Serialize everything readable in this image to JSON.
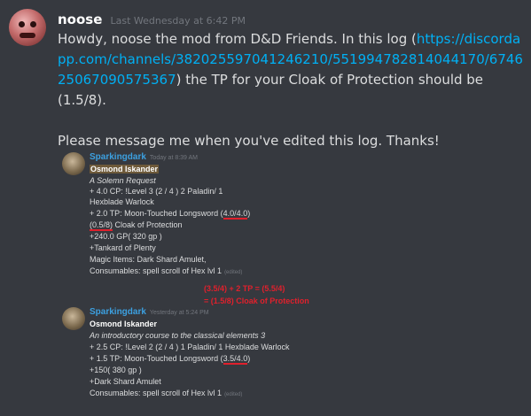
{
  "message": {
    "author": "noose",
    "timestamp": "Last Wednesday at 6:42 PM",
    "text_before_link": "Howdy, noose the mod from D&D Friends. In this log (",
    "link": "https://discordapp.com/channels/382025597041246210/551994782814044170/674625067090575367",
    "text_after_link": ") the TP for your Cloak of Protection should be (1.5/8).",
    "text_2": "Please message me when you've edited this log. Thanks!"
  },
  "embed1": {
    "author": "Sparkingdark",
    "timestamp": "Today at 8:39 AM",
    "lines": {
      "name": "Osmond Iskander",
      "subtitle": "A Solemn Request",
      "cp": "+ 4.0 CP: !Level 3 (2 / 4 ) 2 Paladin/ 1",
      "class2": "Hexblade Warlock",
      "tp_prefix": "+ 2.0 TP: Moon-Touched Longsword (",
      "tp_value": "4.0/4.0",
      "tp_suffix": ")",
      "cloak_value": "(0.5/8)",
      "cloak_suffix": " Cloak of Protection",
      "gp": "+240.0 GP( 320 gp )",
      "tankard": " +Tankard of Plenty",
      "magic": "Magic Items: Dark Shard Amulet,",
      "consumables": "Consumables: spell scroll of Hex lvl 1",
      "edited": "(edited)"
    }
  },
  "annotation": {
    "line1": "(3.5/4) + 2 TP = (5.5/4)",
    "line2": "= (1.5/8) Cloak of Protection"
  },
  "embed2": {
    "author": "Sparkingdark",
    "timestamp": "Yesterday at 5:24 PM",
    "lines": {
      "name": "Osmond Iskander",
      "subtitle": "An introductory course to the classical elements 3",
      "cp": "+ 2.5 CP: !Level 2 (2 / 4 ) 1 Paladin/ 1 Hexblade Warlock",
      "tp_prefix": "+ 1.5 TP: Moon-Touched Longsword (",
      "tp_value": "3.5/4.0",
      "tp_suffix": ")",
      "gp": "+150( 380 gp )",
      "amulet": " +Dark Shard Amulet",
      "consumables": "Consumables: spell scroll of Hex lvl 1",
      "edited": "(edited)"
    }
  },
  "colors": {
    "background": "#36393f",
    "username": "#ffffff",
    "link": "#00b0f4",
    "embed_author": "#3ca0e0",
    "annotation_red": "#e0202c"
  }
}
